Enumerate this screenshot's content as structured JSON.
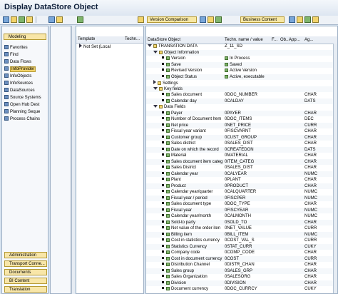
{
  "window": {
    "title": "Display DataStore Object"
  },
  "toolbar": {
    "version_comparison": "Version Comparison",
    "business_content": "Business Content"
  },
  "nav": {
    "modeling_label": "Modeling",
    "items": [
      "Favorites",
      "Find",
      "Data Flows",
      "InfoProvider",
      "InfoObjects",
      "InfoSources",
      "DataSources",
      "Source Systems",
      "Open Hub Dest",
      "Planning Seque",
      "Process Chains"
    ],
    "bottom": [
      "Administration",
      "Transport Conne...",
      "Documents",
      "BI Content",
      "Translation"
    ]
  },
  "template": {
    "col_template": "Template",
    "col_techn": "Techn...",
    "row_label": "Not Set (Local"
  },
  "grid": {
    "headers": {
      "object": "DataStore Object",
      "techn": "Techn. name / value",
      "f": "F...",
      "obj": "Ob...",
      "app": "App...",
      "ag": "Ag..."
    },
    "top": {
      "label": "TRANSATION DATA",
      "tech": "Z_11_SD"
    },
    "object_info": "Object Information",
    "info_rows": [
      {
        "label": "Version",
        "value": "In Process"
      },
      {
        "label": "Save",
        "value": "Saved"
      },
      {
        "label": "Revised Version",
        "value": "Active Version"
      },
      {
        "label": "Object Status",
        "value": "Active, executable"
      }
    ],
    "settings": "Settings",
    "key_fields": "Key fields",
    "key_rows": [
      {
        "label": "Sales document",
        "tech": "0DOC_NUMBER",
        "type": "CHAR"
      },
      {
        "label": "Calendar day",
        "tech": "0CALDAY",
        "type": "DATS"
      }
    ],
    "data_fields": "Data Fields",
    "data_rows": [
      {
        "label": "Payer",
        "tech": "0PAYER",
        "type": "CHAR"
      },
      {
        "label": "Number of Document Item",
        "tech": "0DOC_ITEMS",
        "type": "DEC"
      },
      {
        "label": "Net price",
        "tech": "0NET_PRICE",
        "type": "CURR"
      },
      {
        "label": "Fiscal year variant",
        "tech": "0FISCVARNT",
        "type": "CHAR"
      },
      {
        "label": "Customer group",
        "tech": "0CUST_GROUP",
        "type": "CHAR"
      },
      {
        "label": "Sales district",
        "tech": "0SALES_DIST",
        "type": "CHAR"
      },
      {
        "label": "Date on which the record",
        "tech": "0CREATEDON",
        "type": "DATS"
      },
      {
        "label": "Material",
        "tech": "0MATERIAL",
        "type": "CHAR"
      },
      {
        "label": "Sales document item categ",
        "tech": "0ITEM_CATEG",
        "type": "CHAR"
      },
      {
        "label": "Sales District",
        "tech": "0SALES_DIST",
        "type": "CHAR"
      },
      {
        "label": "Calendar year",
        "tech": "0CALYEAR",
        "type": "NUMC"
      },
      {
        "label": "Plant",
        "tech": "0PLANT",
        "type": "CHAR"
      },
      {
        "label": "Product",
        "tech": "0PRODUCT",
        "type": "CHAR"
      },
      {
        "label": "Calendar year/quarter",
        "tech": "0CALQUARTER",
        "type": "NUMC"
      },
      {
        "label": "Fiscal year / period",
        "tech": "0FISCPER",
        "type": "NUMC"
      },
      {
        "label": "Sales document type",
        "tech": "0DOC_TYPE",
        "type": "CHAR"
      },
      {
        "label": "Fiscal year",
        "tech": "0FISCYEAR",
        "type": "NUMC"
      },
      {
        "label": "Calendar year/month",
        "tech": "0CALMONTH",
        "type": "NUMC"
      },
      {
        "label": "Sold-to party",
        "tech": "0SOLD_TO",
        "type": "CHAR"
      },
      {
        "label": "Net value of the order iten",
        "tech": "0NET_VALUE",
        "type": "CURR"
      },
      {
        "label": "Billing item",
        "tech": "0BILL_ITEM",
        "type": "NUMC"
      },
      {
        "label": "Cost in statistics currency",
        "tech": "0COST_VAL_S",
        "type": "CURR"
      },
      {
        "label": "Statistics Currency",
        "tech": "0STAT_CURR",
        "type": "CUKY"
      },
      {
        "label": "Company code",
        "tech": "0COMP_CODE",
        "type": "CHAR"
      },
      {
        "label": "Cost in document currency",
        "tech": "0COST",
        "type": "CURR"
      },
      {
        "label": "Distribution Channel",
        "tech": "0DISTR_CHAN",
        "type": "CHAR"
      },
      {
        "label": "Sales group",
        "tech": "0SALES_GRP",
        "type": "CHAR"
      },
      {
        "label": "Sales Organization",
        "tech": "0SALESORG",
        "type": "CHAR"
      },
      {
        "label": "Division",
        "tech": "0DIVISION",
        "type": "CHAR"
      },
      {
        "label": "Document currency",
        "tech": "0DOC_CURRCY",
        "type": "CUKY"
      }
    ]
  }
}
